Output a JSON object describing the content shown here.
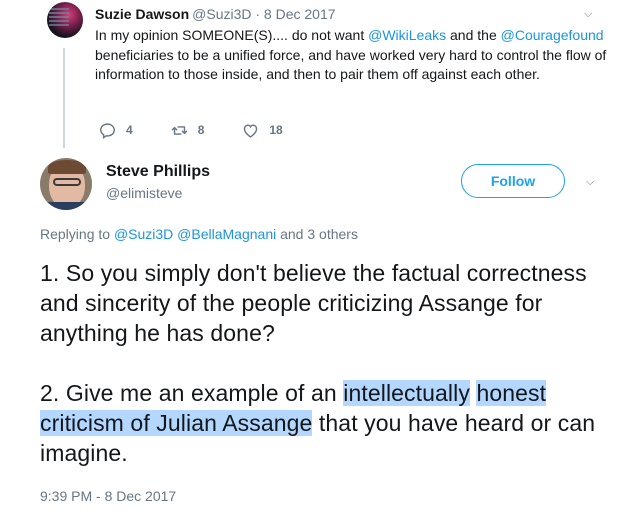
{
  "parent_tweet": {
    "name": "Suzie Dawson",
    "meta": "@Suzi3D · 8 Dec 2017",
    "text_part1": "In my opinion SOMEONE(S).... do not want ",
    "mention1": "@WikiLeaks",
    "text_part2": " and the ",
    "mention2": "@Couragefound",
    "text_part3": " beneficiaries to be a unified force, and have worked very hard to control the flow of information to those inside, and then to pair them off against each other.",
    "reply_count": "4",
    "retweet_count": "8",
    "like_count": "18"
  },
  "main_tweet": {
    "name": "Steve Phillips",
    "handle": "@elimisteve",
    "follow_label": "Follow",
    "replying_prefix": "Replying to ",
    "replying_mention1": "@Suzi3D",
    "replying_mention2": "@BellaMagnani",
    "replying_suffix": " and 3 others",
    "paragraph1": "1. So you simply don't believe the factual correctness and sincerity of the people criticizing Assange for anything he has done?",
    "paragraph2_before": "2. Give me an example of an ",
    "paragraph2_highlight1": "intellectually",
    "paragraph2_highlight2": "honest criticism of Julian Assange",
    "paragraph2_after": " that you have heard or can imagine.",
    "timestamp": "9:39 PM - 8 Dec 2017"
  },
  "icons": {
    "reply": "reply-icon",
    "retweet": "retweet-icon",
    "like": "heart-icon",
    "more": "chevron-down-icon"
  },
  "colors": {
    "link": "#1b95e0",
    "accent": "#1da1f2",
    "secondary_text": "#657786",
    "highlight": "#b3d7fe"
  }
}
